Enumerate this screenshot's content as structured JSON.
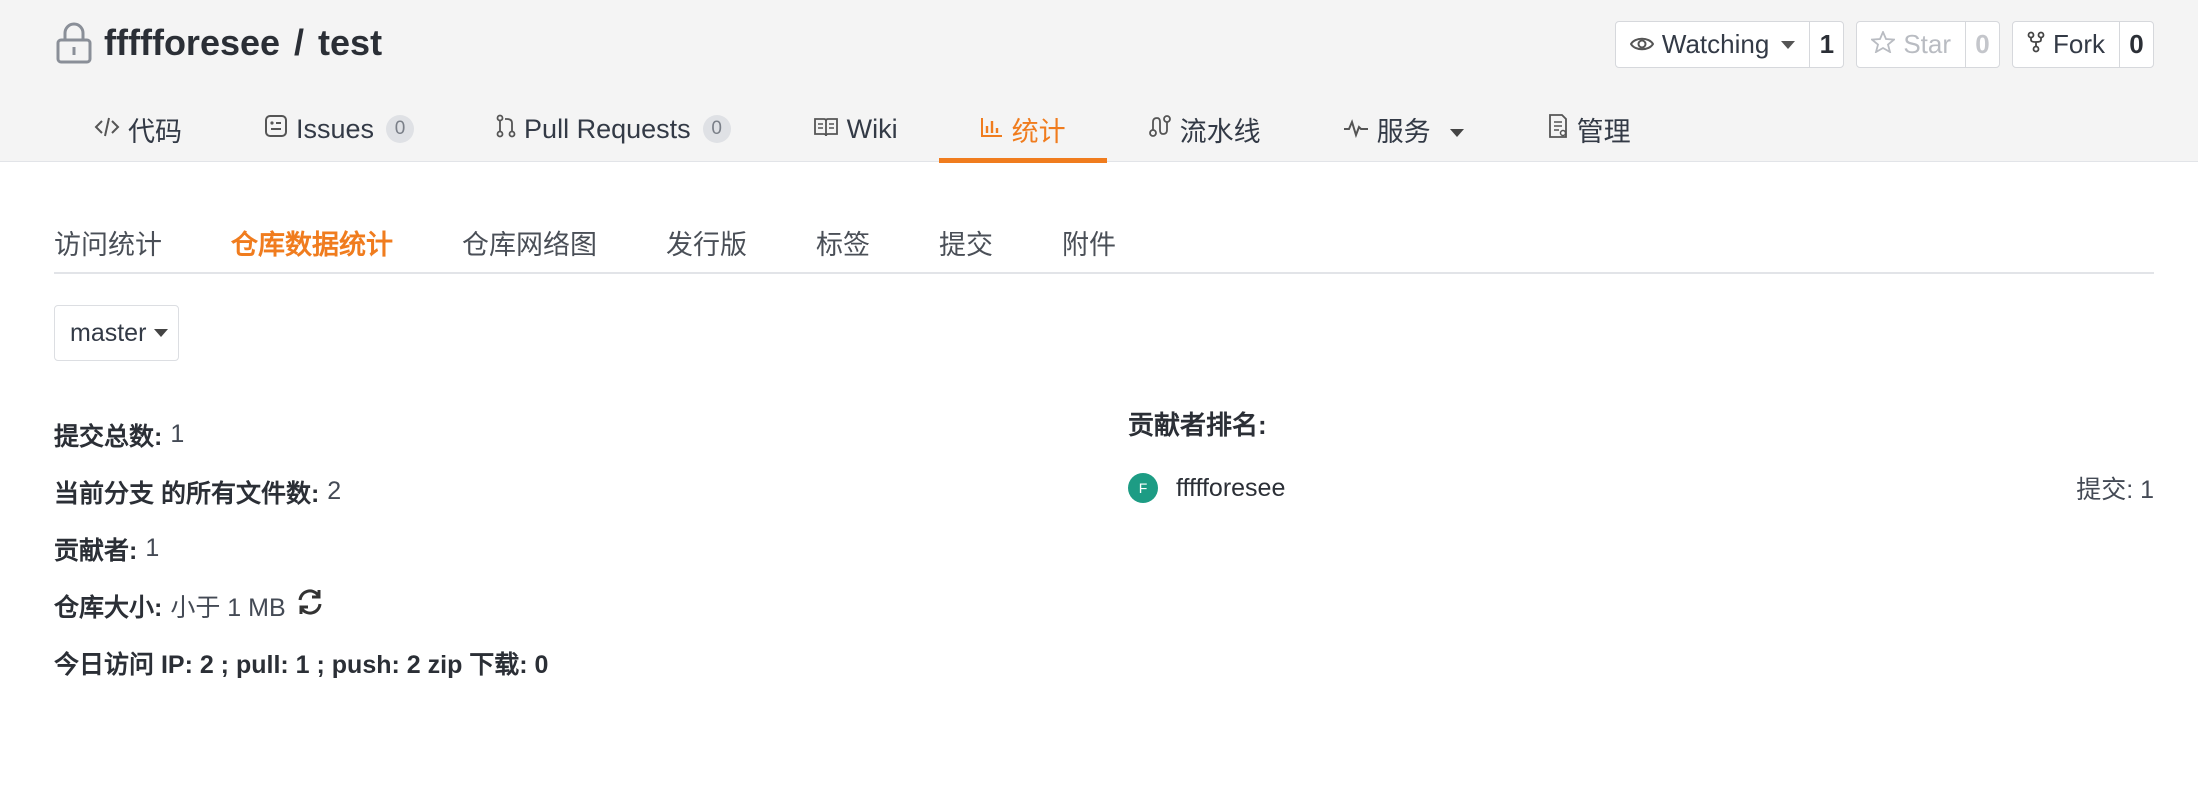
{
  "repo": {
    "owner": "ffffforesee",
    "separator": "/",
    "name": "test"
  },
  "actions": {
    "watch_label": "Watching",
    "watch_count": "1",
    "star_label": "Star",
    "star_count": "0",
    "fork_label": "Fork",
    "fork_count": "0"
  },
  "tabs": [
    {
      "label": "代码",
      "icon": "code-icon"
    },
    {
      "label": "Issues",
      "badge": "0",
      "icon": "issues-icon"
    },
    {
      "label": "Pull Requests",
      "badge": "0",
      "icon": "pull-request-icon"
    },
    {
      "label": "Wiki",
      "icon": "book-icon"
    },
    {
      "label": "统计",
      "icon": "bar-chart-icon",
      "active": true
    },
    {
      "label": "流水线",
      "icon": "pipeline-icon"
    },
    {
      "label": "服务",
      "icon": "pulse-icon"
    },
    {
      "label": "管理",
      "icon": "settings-doc-icon"
    }
  ],
  "subtabs": [
    "访问统计",
    "仓库数据统计",
    "仓库网络图",
    "发行版",
    "标签",
    "提交",
    "附件"
  ],
  "branch": "master",
  "stats": {
    "commits_key": "提交总数:",
    "commits_val": "1",
    "files_key": "当前分支 的所有文件数:",
    "files_val": "2",
    "contributors_key": "贡献者:",
    "contributors_val": "1",
    "size_key": "仓库大小:",
    "size_val": "小于 1 MB",
    "today_line": "今日访问 IP: 2 ; pull: 1 ; push: 2 zip 下载: 0"
  },
  "contributors": {
    "title": "贡献者排名:",
    "list": [
      {
        "initial": "F",
        "name": "ffffforesee",
        "commits": "提交: 1"
      }
    ]
  },
  "colors": {
    "accent": "#f07c1e",
    "avatar": "#1d9c84"
  }
}
